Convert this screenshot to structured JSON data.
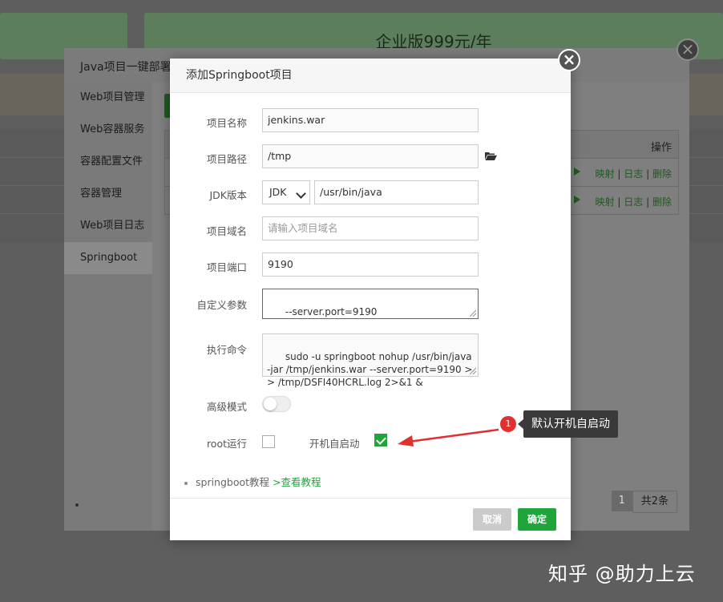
{
  "background": {
    "banner_text": "企业版999元/年"
  },
  "java_window": {
    "title": "Java项目一键部署",
    "sidebar": [
      {
        "label": "Web项目管理",
        "active": false
      },
      {
        "label": "Web容器服务",
        "active": false
      },
      {
        "label": "容器配置文件",
        "active": false
      },
      {
        "label": "容器管理",
        "active": false
      },
      {
        "label": "Web项目日志",
        "active": false
      },
      {
        "label": "Springboot",
        "active": true
      }
    ],
    "table": {
      "header_action": "操作",
      "rows": [
        {
          "map": "映射",
          "log": "日志",
          "delete": "删除"
        },
        {
          "map": "映射",
          "log": "日志",
          "delete": "删除"
        }
      ],
      "separator": "|"
    },
    "pagination": {
      "current": "1",
      "total": "共2条"
    }
  },
  "dialog": {
    "title": "添加Springboot项目",
    "fields": {
      "project_name": {
        "label": "项目名称",
        "value": "jenkins.war"
      },
      "project_path": {
        "label": "项目路径",
        "value": "/tmp"
      },
      "jdk": {
        "label": "JDK版本",
        "select_value": "JDK",
        "path_value": "/usr/bin/java"
      },
      "domain": {
        "label": "项目域名",
        "placeholder": "请输入项目域名"
      },
      "port": {
        "label": "项目端口",
        "value": "9190"
      },
      "custom_args": {
        "label": "自定义参数",
        "value": "--server.port=9190"
      },
      "command": {
        "label": "执行命令",
        "value": "sudo -u springboot nohup /usr/bin/java -jar /tmp/jenkins.war --server.port=9190 >> /tmp/DSFI40HCRL.log 2>&1 &"
      },
      "advanced": {
        "label": "高级模式",
        "enabled": false
      },
      "root_run": {
        "label": "root运行",
        "checked": false
      },
      "autostart": {
        "label": "开机自启动",
        "checked": true
      }
    },
    "tutorial": {
      "text": "springboot教程",
      "link": ">查看教程"
    },
    "buttons": {
      "cancel": "取消",
      "ok": "确定"
    }
  },
  "annotation": {
    "badge": "1",
    "text": "默认开机自启动"
  },
  "watermark": "知乎 @助力上云",
  "colors": {
    "accent": "#20a53a",
    "annotation_red": "#e03030"
  }
}
